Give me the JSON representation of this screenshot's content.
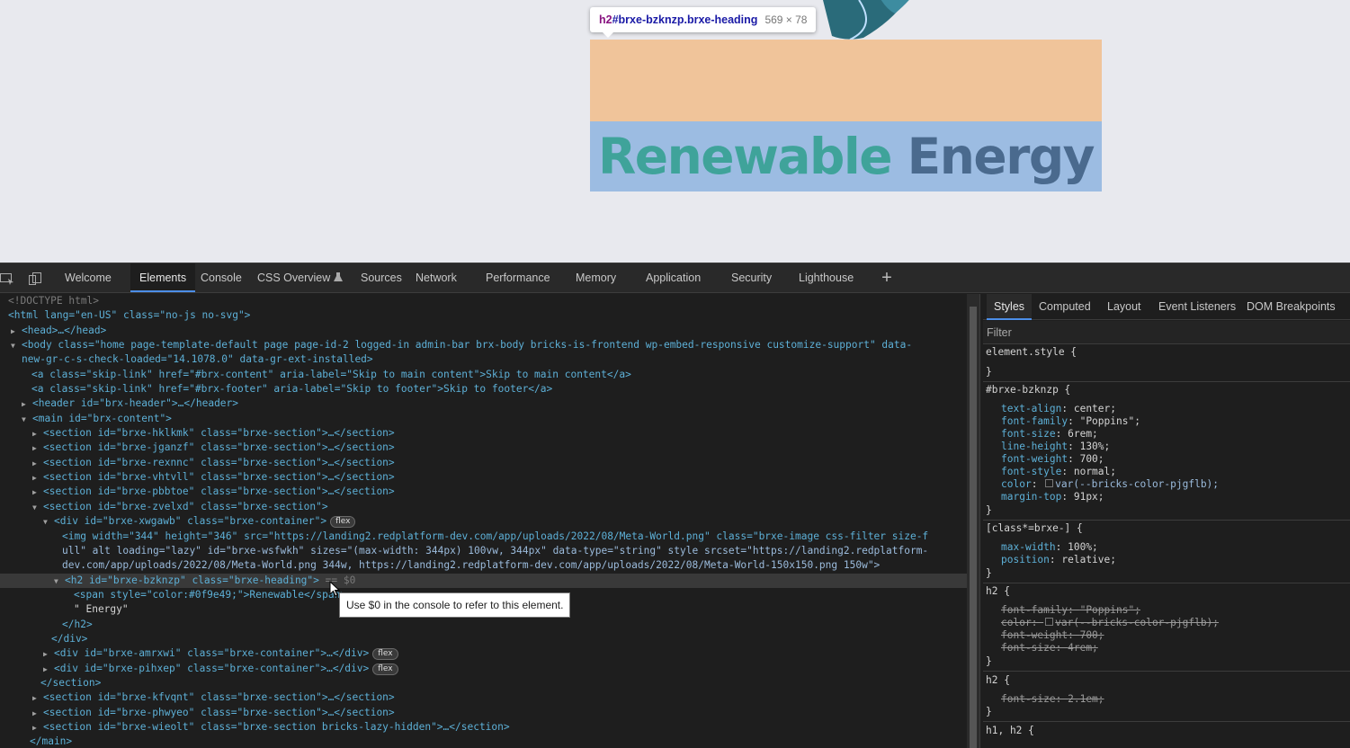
{
  "viewport": {
    "tooltip": {
      "tag": "h2",
      "selector": "#brxe-bzknzp.brxe-heading",
      "dims": "569 × 78"
    },
    "heading": {
      "word1": "Renewable",
      "word2": " Energy"
    }
  },
  "devtools": {
    "tabs": [
      "Welcome",
      "Elements",
      "Console",
      "CSS Overview",
      "Sources",
      "Network",
      "Performance",
      "Memory",
      "Application",
      "Security",
      "Lighthouse"
    ],
    "active_tab": "Elements",
    "dom_lines": [
      "<!DOCTYPE html>",
      "<html lang=\"en-US\" class=\"no-js no-svg\">",
      "<head>…</head>",
      "<body class=\"home page-template-default page page-id-2 logged-in admin-bar brx-body bricks-is-frontend wp-embed-responsive customize-support\" data-",
      "new-gr-c-s-check-loaded=\"14.1078.0\" data-gr-ext-installed>",
      "<a class=\"skip-link\" href=\"#brx-content\" aria-label=\"Skip to main content\">Skip to main content</a>",
      "<a class=\"skip-link\" href=\"#brx-footer\" aria-label=\"Skip to footer\">Skip to footer</a>",
      "<header id=\"brx-header\">…</header>",
      "<main id=\"brx-content\">",
      "<section id=\"brxe-hklkmk\" class=\"brxe-section\">…</section>",
      "<section id=\"brxe-jganzf\" class=\"brxe-section\">…</section>",
      "<section id=\"brxe-rexnnc\" class=\"brxe-section\">…</section>",
      "<section id=\"brxe-vhtvll\" class=\"brxe-section\">…</section>",
      "<section id=\"brxe-pbbtoe\" class=\"brxe-section\">…</section>",
      "<section id=\"brxe-zvelxd\" class=\"brxe-section\">",
      "<div id=\"brxe-xwgawb\" class=\"brxe-container\">",
      "<img width=\"344\" height=\"346\" src=\"https://landing2.redplatform-dev.com/app/uploads/2022/08/Meta-World.png\" class=\"brxe-image css-filter size-f",
      "ull\" alt loading=\"lazy\" id=\"brxe-wsfwkh\" sizes=\"(max-width: 344px) 100vw, 344px\" data-type=\"string\" style srcset=\"https://landing2.redplatform-",
      "dev.com/app/uploads/2022/08/Meta-World.png 344w, https://landing2.redplatform-dev.com/app/uploads/2022/08/Meta-World-150x150.png 150w\">",
      "<h2 id=\"brxe-bzknzp\" class=\"brxe-heading\">",
      "<span style=\"color:#0f9e49;\">Renewable</span>",
      "\" Energy\"",
      "</h2>",
      "</div>",
      "<div id=\"brxe-amrxwi\" class=\"brxe-container\">…</div>",
      "<div id=\"brxe-pihxep\" class=\"brxe-container\">…</div>",
      "</section>",
      "<section id=\"brxe-kfvqnt\" class=\"brxe-section\">…</section>",
      "<section id=\"brxe-phwyeo\" class=\"brxe-section\">…</section>",
      "<section id=\"brxe-wieolt\" class=\"brxe-section bricks-lazy-hidden\">…</section>",
      "</main>"
    ],
    "badge_flex": "flex",
    "console_ref": "== $0",
    "tooltip_console": "Use $0 in the console to refer to this element.",
    "style_tabs": [
      "Styles",
      "Computed",
      "Layout",
      "Event Listeners",
      "DOM Breakpoints"
    ],
    "active_style_tab": "Styles",
    "filter_placeholder": "Filter",
    "rules": {
      "element_style": "element.style {",
      "brace_close": "}",
      "r1_selector": "#brxe-bzknzp {",
      "r1_props": [
        [
          "text-align",
          "center;"
        ],
        [
          "font-family",
          "\"Poppins\";"
        ],
        [
          "font-size",
          "6rem;"
        ],
        [
          "line-height",
          "130%;"
        ],
        [
          "font-weight",
          "700;"
        ],
        [
          "font-style",
          "normal;"
        ],
        [
          "color",
          "var(--bricks-color-pjgflb);"
        ],
        [
          "margin-top",
          "91px;"
        ]
      ],
      "r2_selector": "[class*=brxe-] {",
      "r2_props": [
        [
          "max-width",
          "100%;"
        ],
        [
          "position",
          "relative;"
        ]
      ],
      "r3_selector": "h2 {",
      "r3_props": [
        [
          "font-family",
          "\"Poppins\";"
        ],
        [
          "color",
          "var(--bricks-color-pjgflb);"
        ],
        [
          "font-weight",
          "700;"
        ],
        [
          "font-size",
          "4rem;"
        ]
      ],
      "r4_selector": "h2 {",
      "r4_props": [
        [
          "font-size",
          "2.1em;"
        ]
      ],
      "r5_selector": "h1, h2 {"
    }
  }
}
